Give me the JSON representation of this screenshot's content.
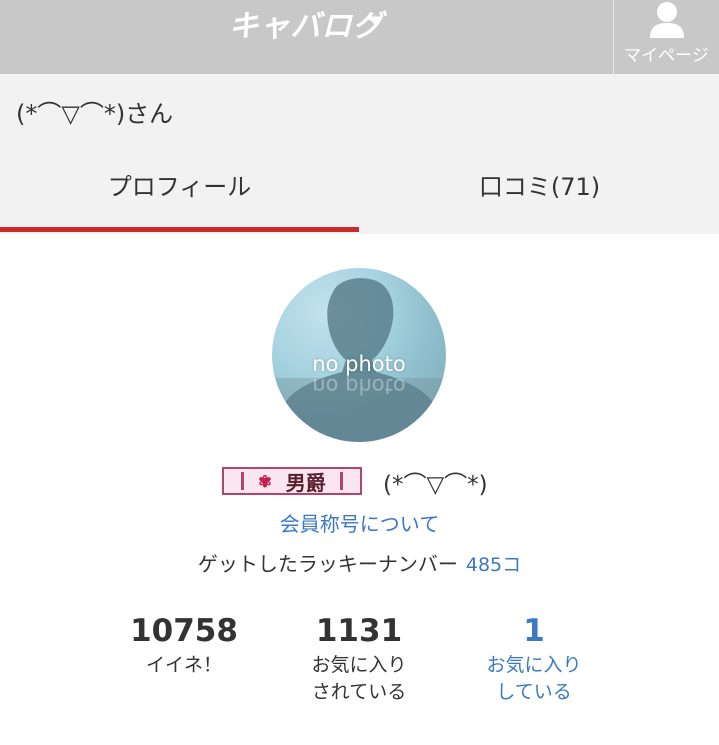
{
  "header": {
    "logo_text": "キャバログ",
    "mypage_label": "マイページ"
  },
  "user": {
    "display_name": "(*⌒▽⌒*)さん",
    "nickname": "(*⌒▽⌒*)"
  },
  "tabs": [
    {
      "label": "プロフィール",
      "active": true
    },
    {
      "label": "口コミ(71)",
      "active": false
    }
  ],
  "avatar": {
    "placeholder_text": "no photo"
  },
  "rank_badge": {
    "label": "男爵"
  },
  "title_link": "会員称号について",
  "lucky": {
    "label": "ゲットしたラッキーナンバー",
    "count": "485コ"
  },
  "stats": [
    {
      "value": "10758",
      "label": "イイネ！",
      "link": false
    },
    {
      "value": "1131",
      "label_line1": "お気に入り",
      "label_line2": "されている",
      "link": false
    },
    {
      "value": "1",
      "label_line1": "お気に入り",
      "label_line2": "している",
      "link": true
    }
  ],
  "colors": {
    "header_bg": "#c8c8c8",
    "tab_active_underline": "#cc2b2b",
    "link": "#3b79c4"
  }
}
